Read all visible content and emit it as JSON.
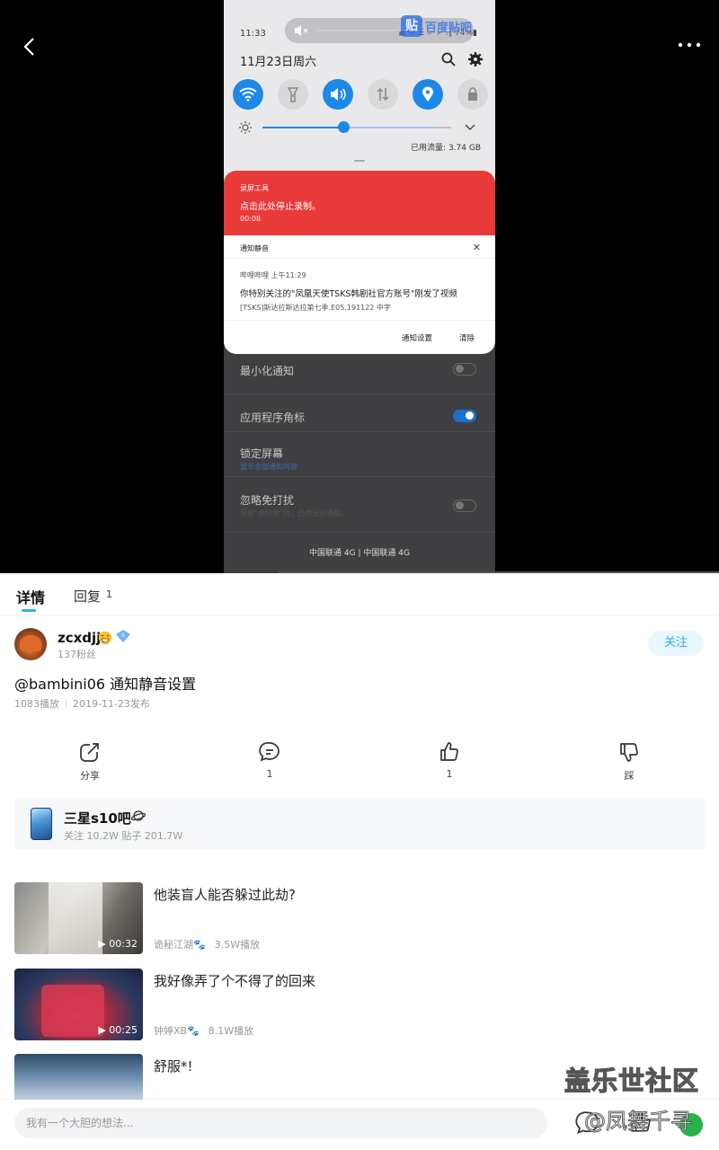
{
  "video": {
    "status_time": "11:33",
    "status_right": "▣ N ☰ ↗ ↗ .∥ 74%▮",
    "watermark_badge": "贴",
    "watermark_text": "百度贴吧",
    "date": "11月23日周六",
    "data_usage": "已用流量: 3.74 GB",
    "brightness_level": 0.43,
    "rec_app": "录屏工具",
    "rec_msg": "点击此处停止录制。",
    "rec_time": "00:08",
    "notif_header": "通知静音",
    "notif_app": "哔哩哔哩  上午11:29",
    "notif_title": "你特别关注的\"凤凰天使TSKS韩剧社官方账号\"刚发了视频",
    "notif_sub": "[TSKS]斯达拉斯达拉第七季.E05.191122 中字",
    "notif_btn_settings": "通知设置",
    "notif_btn_clear": "清除",
    "setting_minimize": "最小化通知",
    "setting_badge": "应用程序角标",
    "setting_lock": "锁定屏幕",
    "setting_lock_sub": "显示全部通知内容",
    "setting_dnd": "忽略免打扰",
    "setting_dnd_sub": "开启“免打扰”时，仍然允许通知。",
    "carrier": "中国联通 4G | 中国联通 4G"
  },
  "tabs": {
    "detail": "详情",
    "reply": "回复",
    "reply_count": "1"
  },
  "author": {
    "name": "zcxdjj",
    "fans": "137粉丝",
    "follow_label": "关注"
  },
  "post": {
    "title": "@bambini06 通知静音设置",
    "plays": "1083播放",
    "date": "2019-11-23发布"
  },
  "actions": {
    "share": "分享",
    "comments": "1",
    "likes": "1",
    "dislike": "踩"
  },
  "forum": {
    "name": "三星s10吧",
    "stats": "关注 10.2W   贴子 201.7W"
  },
  "videos": [
    {
      "title": "他装盲人能否躲过此劫?",
      "duration": "00:32",
      "author": "诡秘江湖🐾",
      "plays": "3.5W播放"
    },
    {
      "title": "我好像弄了个不得了的回来",
      "duration": "00:25",
      "author": "钟婷XB🐾",
      "plays": "8.1W播放"
    },
    {
      "title": "舒服*!"
    }
  ],
  "comment": {
    "placeholder": "我有一个大胆的想法..."
  },
  "watermark": {
    "line1": "盖乐世社区",
    "line2": "@凤舞千寻"
  }
}
